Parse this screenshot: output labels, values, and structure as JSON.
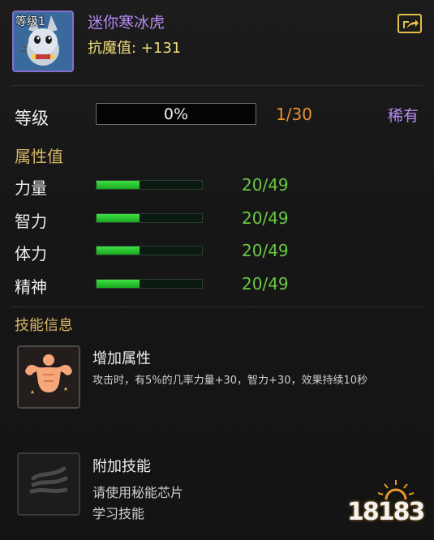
{
  "pet": {
    "avatar_level_label": "等级1",
    "name": "迷你寒冰虎",
    "resist": "抗魔值:  +131"
  },
  "level": {
    "label": "等级",
    "progress_percent": 0,
    "progress_text": "0%",
    "count": "1/30",
    "rarity": "稀有"
  },
  "attributes": {
    "title": "属性值",
    "items": [
      {
        "label": "力量",
        "value": "20/49",
        "fraction": 0.408
      },
      {
        "label": "智力",
        "value": "20/49",
        "fraction": 0.408
      },
      {
        "label": "体力",
        "value": "20/49",
        "fraction": 0.408
      },
      {
        "label": "精神",
        "value": "20/49",
        "fraction": 0.408
      }
    ]
  },
  "skills": {
    "title": "技能信息",
    "items": [
      {
        "name": "增加属性",
        "icon": "muscle-icon",
        "desc": "攻击时，有5%的几率力量+30，智力+30，效果持续10秒"
      },
      {
        "name": "附加技能",
        "icon": "locked-skill-icon",
        "desc_lines": [
          "请使用秘能芯片",
          "学习技能"
        ]
      }
    ]
  },
  "watermark": {
    "text": "18183"
  },
  "colors": {
    "rarity": "#b68cf6",
    "level_count": "#e8922e",
    "stat_value": "#69c940",
    "section_title": "#d8b664",
    "resist": "#f0dc78",
    "bar_fill": "#2ec236"
  }
}
